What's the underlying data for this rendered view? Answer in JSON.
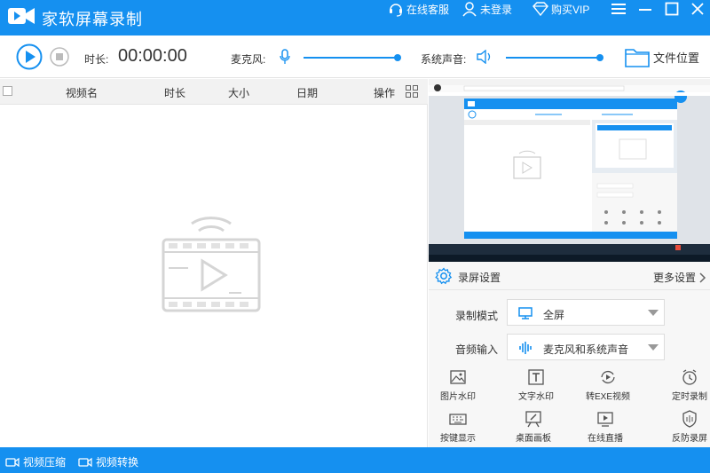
{
  "titlebar": {
    "app_title": "家软屏幕录制",
    "online_service": "在线客服",
    "not_logged_in": "未登录",
    "buy_vip": "购买VIP",
    "accent_color": "#1590f0"
  },
  "toolbar": {
    "duration_label": "时长:",
    "duration_value": "00:00:00",
    "mic_label": "麦克风:",
    "system_sound_label": "系统声音:",
    "file_location": "文件位置"
  },
  "file_list": {
    "columns": [
      "视频名",
      "时长",
      "大小",
      "日期",
      "操作"
    ]
  },
  "settings": {
    "title": "录屏设置",
    "more_settings": "更多设置",
    "record_mode_label": "录制模式",
    "record_mode_value": "全屏",
    "audio_input_label": "音频输入",
    "audio_input_value": "麦克风和系统声音",
    "tools": [
      {
        "label": "图片水印",
        "icon": "image-icon"
      },
      {
        "label": "文字水印",
        "icon": "text-icon"
      },
      {
        "label": "转EXE视频",
        "icon": "convert-icon"
      },
      {
        "label": "定时录制",
        "icon": "alarm-icon"
      },
      {
        "label": "按键显示",
        "icon": "keyboard-icon"
      },
      {
        "label": "桌面画板",
        "icon": "whiteboard-icon"
      },
      {
        "label": "在线直播",
        "icon": "live-icon"
      },
      {
        "label": "反防录屏",
        "icon": "shield-icon"
      }
    ]
  },
  "statusbar": {
    "video_compress": "视频压缩",
    "video_convert": "视频转换"
  }
}
